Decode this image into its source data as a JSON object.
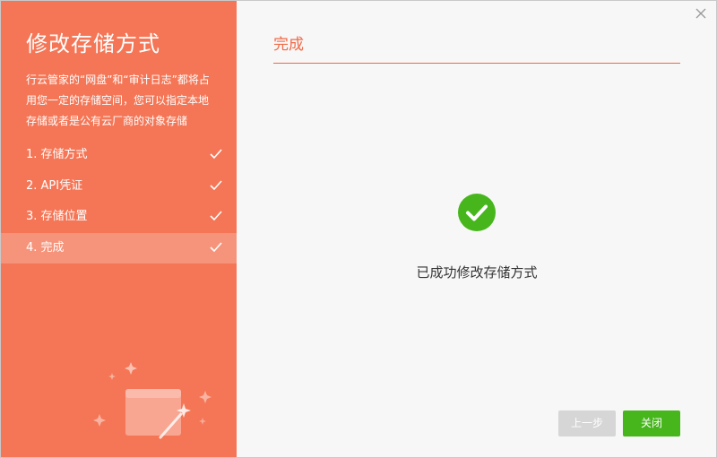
{
  "sidebar": {
    "title": "修改存储方式",
    "description": "行云管家的“网盘”和“审计日志”都将占用您一定的存储空间，您可以指定本地存储或者是公有云厂商的对象存储",
    "steps": [
      {
        "label": "1. 存储方式",
        "done": true
      },
      {
        "label": "2. API凭证",
        "done": true
      },
      {
        "label": "3. 存储位置",
        "done": true
      },
      {
        "label": "4. 完成",
        "done": true,
        "active": true
      }
    ]
  },
  "main": {
    "title": "完成",
    "success_message": "已成功修改存储方式",
    "buttons": {
      "prev_label": "上一步",
      "close_label": "关闭"
    }
  },
  "icons": {
    "close": "close-icon",
    "step_check": "check-icon",
    "success": "success-check-circle-icon",
    "illustration": "magic-wand-card-icon"
  },
  "colors": {
    "sidebar_bg": "#f47656",
    "accent": "#f06a47",
    "success": "#47b61d",
    "disabled": "#d6d6d6"
  }
}
